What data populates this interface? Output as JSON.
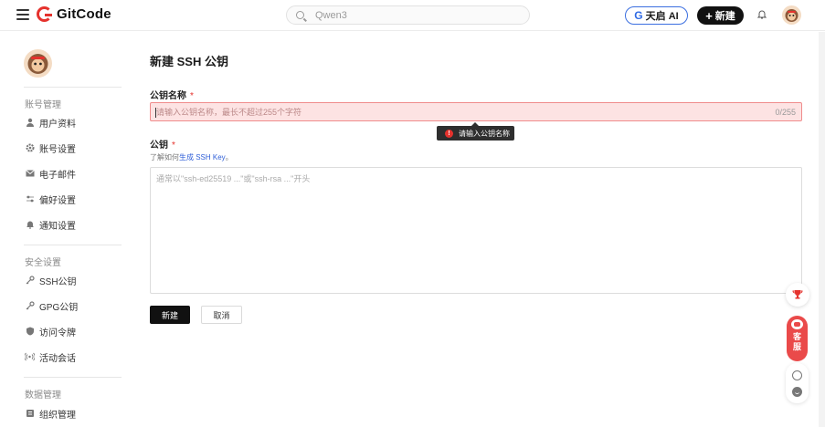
{
  "header": {
    "logo_text": "GitCode",
    "search_placeholder": "Qwen3",
    "ai_g": "G",
    "ai_label": "天启 AI",
    "new_label": "新建",
    "new_plus": "+",
    "brand_color": "#e5322d"
  },
  "sidebar": {
    "sections": [
      {
        "title": "账号管理",
        "items": [
          {
            "label": "用户资料",
            "icon": "user-icon"
          },
          {
            "label": "账号设置",
            "icon": "gear-icon"
          },
          {
            "label": "电子邮件",
            "icon": "mail-icon"
          },
          {
            "label": "偏好设置",
            "icon": "sliders-icon"
          },
          {
            "label": "通知设置",
            "icon": "bell-icon"
          }
        ]
      },
      {
        "title": "安全设置",
        "items": [
          {
            "label": "SSH公钥",
            "icon": "key-icon"
          },
          {
            "label": "GPG公钥",
            "icon": "key-icon"
          },
          {
            "label": "访问令牌",
            "icon": "shield-icon"
          },
          {
            "label": "活动会话",
            "icon": "signal-icon"
          }
        ]
      },
      {
        "title": "数据管理",
        "items": [
          {
            "label": "组织管理",
            "icon": "org-icon"
          }
        ]
      }
    ]
  },
  "main": {
    "title": "新建 SSH 公钥",
    "name_label": "公钥名称",
    "required_mark": "*",
    "name_placeholder": "请输入公钥名称，最长不超过255个字符",
    "name_value": "",
    "name_counter": "0/255",
    "error_icon": "!",
    "error_text": "请输入公钥名称",
    "key_label": "公钥",
    "help_prefix": "了解如何",
    "help_link": "生成 SSH Key",
    "help_suffix": "。",
    "key_placeholder": "通常以\"ssh-ed25519 ...\"或\"ssh-rsa ...\"开头",
    "key_value": "",
    "submit_label": "新建",
    "cancel_label": "取消"
  },
  "floating": {
    "service_label_1": "客",
    "service_label_2": "服",
    "service_color": "#ea4a4a"
  }
}
